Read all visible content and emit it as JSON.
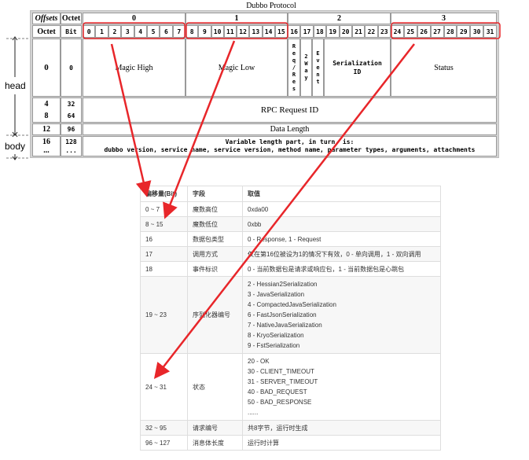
{
  "title": "Dubbo Protocol",
  "header": {
    "offsets": "Offsets",
    "octet": "Octet",
    "octet_col": "Octet",
    "bit_col": "Bit",
    "octet_numbers": [
      "0",
      "1",
      "2",
      "3"
    ],
    "bits": [
      "0",
      "1",
      "2",
      "3",
      "4",
      "5",
      "6",
      "7",
      "8",
      "9",
      "10",
      "11",
      "12",
      "13",
      "14",
      "15",
      "16",
      "17",
      "18",
      "19",
      "20",
      "21",
      "22",
      "23",
      "24",
      "25",
      "26",
      "27",
      "28",
      "29",
      "30",
      "31"
    ]
  },
  "rows": {
    "row0": {
      "octet": "0",
      "bit": "0",
      "magic_high": "Magic High",
      "magic_low": "Magic Low",
      "req_res": [
        "R",
        "e",
        "q",
        "/",
        "R",
        "e",
        "s"
      ],
      "two_way": [
        "2",
        "W",
        "a",
        "y"
      ],
      "event": [
        "E",
        "v",
        "e",
        "n",
        "t"
      ],
      "serialization": "Serialization ID",
      "status": "Status"
    },
    "row4": {
      "octets": [
        "4",
        "8"
      ],
      "bits": [
        "32",
        "64"
      ],
      "label": "RPC Request ID"
    },
    "row12": {
      "octet": "12",
      "bit": "96",
      "label": "Data Length"
    },
    "row16": {
      "octet": "16",
      "octet_more": "...",
      "bit": "128",
      "bit_more": "...",
      "line1": "Variable length part, in turn, is:",
      "line2": "dubbo version, service name, service version, method name, parameter types, arguments, attachments"
    }
  },
  "side_labels": {
    "head": "head",
    "body": "body"
  },
  "table": {
    "columns": [
      "偏移量(Bit)",
      "字段",
      "取值"
    ],
    "rows": [
      {
        "offset": "0 ~ 7",
        "field": "魔数高位",
        "values": [
          "0xda00"
        ]
      },
      {
        "offset": "8 ~ 15",
        "field": "魔数低位",
        "values": [
          "0xbb"
        ]
      },
      {
        "offset": "16",
        "field": "数据包类型",
        "values": [
          "0 - Response, 1 - Request"
        ]
      },
      {
        "offset": "17",
        "field": "调用方式",
        "values": [
          "仅在第16位被设为1的情况下有效，0 - 单向调用，1 - 双向调用"
        ]
      },
      {
        "offset": "18",
        "field": "事件标识",
        "values": [
          "0 - 当前数据包是请求或响应包，1 - 当前数据包是心跳包"
        ]
      },
      {
        "offset": "19 ~ 23",
        "field": "序列化器编号",
        "values": [
          "2 - Hessian2Serialization",
          "3 - JavaSerialization",
          "4 - CompactedJavaSerialization",
          "6 - FastJsonSerialization",
          "7 - NativeJavaSerialization",
          "8 - KryoSerialization",
          "9 - FstSerialization"
        ]
      },
      {
        "offset": "24 ~ 31",
        "field": "状态",
        "values": [
          "20 - OK",
          "30 - CLIENT_TIMEOUT",
          "31 - SERVER_TIMEOUT",
          "40 - BAD_REQUEST",
          "50 - BAD_RESPONSE",
          "......"
        ]
      },
      {
        "offset": "32 ~ 95",
        "field": "请求编号",
        "values": [
          "共8字节，运行时生成"
        ]
      },
      {
        "offset": "96 ~ 127",
        "field": "消息体长度",
        "values": [
          "运行时计算"
        ]
      }
    ]
  },
  "colors": {
    "highlight": "#e8262a",
    "border": "#9a9a9a",
    "frame": "#d4d4d4"
  }
}
